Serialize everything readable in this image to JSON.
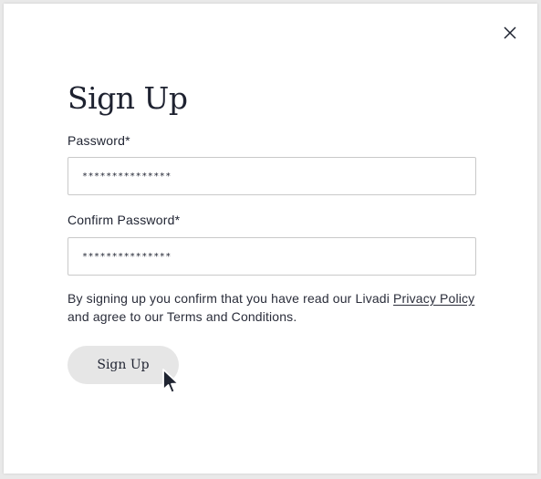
{
  "modal": {
    "title": "Sign Up",
    "close_icon": "close-icon"
  },
  "form": {
    "password": {
      "label": "Password*",
      "value": "***************"
    },
    "confirm_password": {
      "label": "Confirm Password*",
      "value": "***************"
    }
  },
  "disclaimer": {
    "before": "By signing up you confirm that you have read our Livadi ",
    "link": "Privacy Policy ",
    "after": "and agree to our Terms and Conditions."
  },
  "actions": {
    "submit_label": "Sign Up"
  },
  "pointer": {
    "icon": "mouse-pointer-icon"
  },
  "colors": {
    "text": "#1e2230",
    "button_bg": "#e6e6e6",
    "border": "#c9c9c9"
  }
}
